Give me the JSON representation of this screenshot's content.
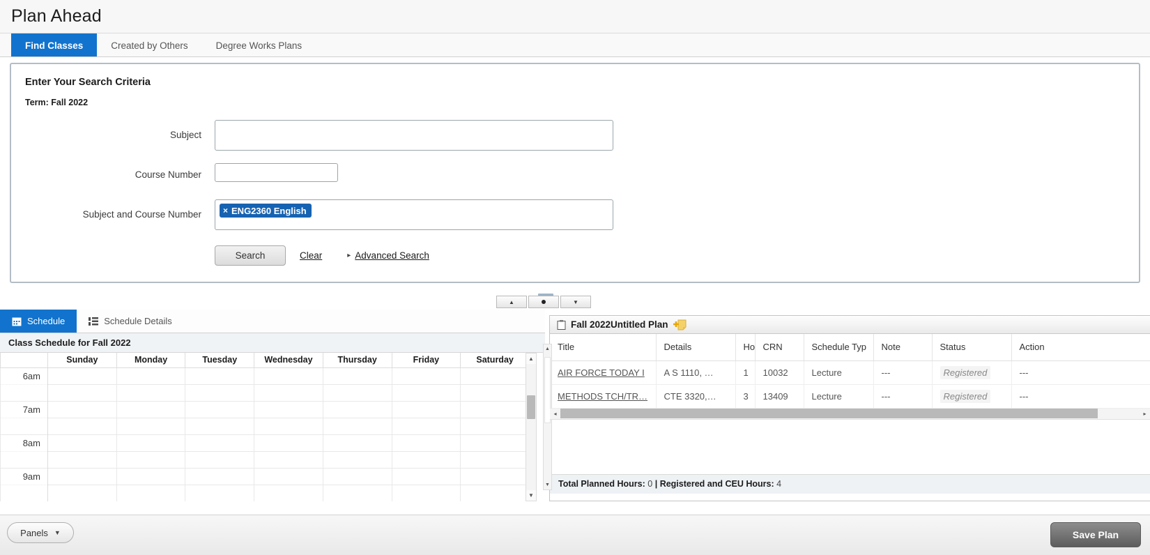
{
  "header": {
    "title": "Plan Ahead"
  },
  "tabs": [
    {
      "label": "Find Classes",
      "active": true
    },
    {
      "label": "Created by Others",
      "active": false
    },
    {
      "label": "Degree Works Plans",
      "active": false
    }
  ],
  "criteria": {
    "heading": "Enter Your Search Criteria",
    "term": "Term: Fall 2022",
    "fields": {
      "subject_label": "Subject",
      "subject_value": "",
      "subject_placeholder": "",
      "course_number_label": "Course Number",
      "course_number_value": "",
      "course_number_placeholder": "",
      "subject_and_course_label": "Subject and Course Number",
      "subject_and_course_chip": "ENG2360 English",
      "chip_remove": "×"
    },
    "actions": {
      "search": "Search",
      "clear": "Clear",
      "advanced": "Advanced Search",
      "advanced_caret": "▸"
    }
  },
  "splitter": {
    "expand_up": "▲",
    "restore": "",
    "collapse_down": "▼"
  },
  "schedule_panel": {
    "tabs": [
      {
        "label": "Schedule",
        "icon": "calendar-icon",
        "active": true
      },
      {
        "label": "Schedule Details",
        "icon": "list-detail-icon",
        "active": false
      }
    ],
    "caption": "Class Schedule for Fall 2022",
    "days": [
      "Sunday",
      "Monday",
      "Tuesday",
      "Wednesday",
      "Thursday",
      "Friday",
      "Saturday"
    ],
    "times": [
      "6am",
      "7am",
      "8am",
      "9am"
    ],
    "scroll_up": "▲",
    "scroll_down": "▼"
  },
  "plan_panel": {
    "title": "Fall 2022Untitled Plan",
    "title_icon": "clipboard-icon",
    "add_icon": "add-note-icon",
    "columns": [
      "Title",
      "Details",
      "Hour",
      "CRN",
      "Schedule Typ",
      "Note",
      "Status",
      "Action"
    ],
    "rows": [
      {
        "title": "AIR FORCE TODAY I",
        "details": "A S 1110, …",
        "hours": "1",
        "crn": "10032",
        "schedule_type": "Lecture",
        "note": "---",
        "status": "Registered",
        "action": "---"
      },
      {
        "title": "METHODS TCH/TR…",
        "details": "CTE 3320,…",
        "hours": "3",
        "crn": "13409",
        "schedule_type": "Lecture",
        "note": "---",
        "status": "Registered",
        "action": "---"
      }
    ],
    "hscroll_left": "◂",
    "hscroll_right": "▸",
    "vscroll_up": "▲",
    "vscroll_down": "▼",
    "totals": {
      "planned_label": "Total Planned Hours:",
      "planned_value": "0",
      "separator": "|",
      "registered_label": "Registered and CEU Hours:",
      "registered_value": "4"
    }
  },
  "footer": {
    "panels_label": "Panels",
    "panels_caret": "▼",
    "save_label": "Save Plan"
  },
  "colors": {
    "accent_blue": "#1173cd",
    "chip_blue": "#1662b2",
    "card_border": "#b3bdc6",
    "save_grey": "#6d6d6d"
  }
}
